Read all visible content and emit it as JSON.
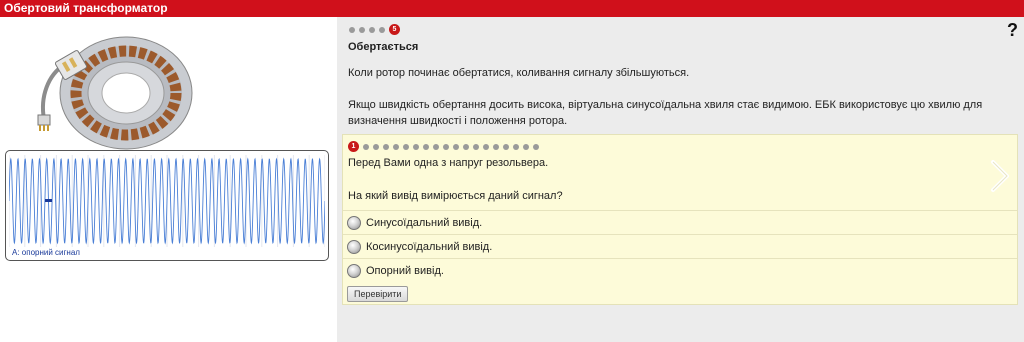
{
  "window": {
    "title": "Обертовий трансформатор"
  },
  "scope": {
    "label": "A: опорний сигнал",
    "trace_color": "#4a7fd6",
    "cycles": 44
  },
  "lesson": {
    "pager": {
      "total": 5,
      "current": "5"
    },
    "help": "?",
    "title": "Обертається",
    "paragraph1": "Коли ротор починає обертатися, коливання сигналу збільшуються.",
    "paragraph2": "Якщо швидкість обертання досить висока, віртуальна синусоїдальна хвиля стає видимою. ЕБК використовує цю хвилю для визначення швидкості і положення ротора."
  },
  "quiz": {
    "pager": {
      "total": 19,
      "current": "1"
    },
    "question_line1": "Перед Вами одна з напруг резольвера.",
    "question_line2": "На який вивід вимірюється даний сигнал?",
    "options": [
      {
        "label": "Синусоїдальний вивід."
      },
      {
        "label": "Косинусоїдальний вивід."
      },
      {
        "label": "Опорний вивід."
      }
    ],
    "check_button": "Перевірити"
  },
  "colors": {
    "title_bar": "#d0101b",
    "quiz_background": "#fdfbd9",
    "panel_background": "#ececec",
    "active_dot": "#c81818"
  }
}
